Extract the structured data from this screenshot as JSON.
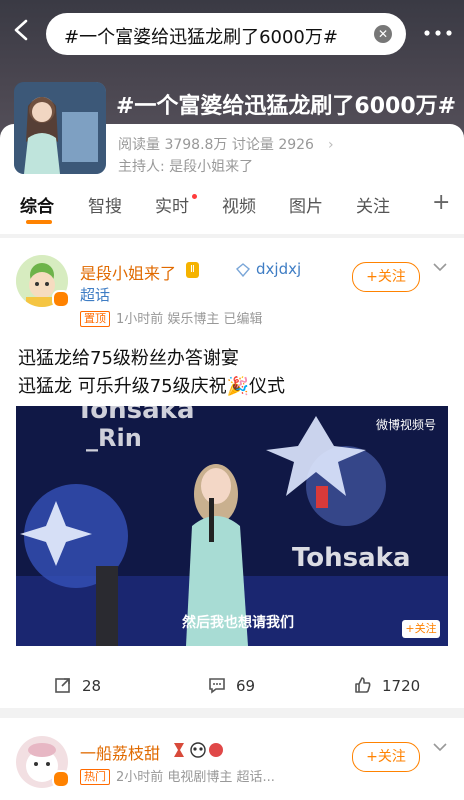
{
  "header": {
    "search_query": "#一个富婆给迅猛龙刷了6000万#"
  },
  "topic": {
    "title": "#一个富婆给迅猛龙刷了6000万#",
    "stats": "阅读量 3798.8万  讨论量 2926",
    "host": "主持人:  是段小姐来了"
  },
  "tabs": [
    {
      "label": "综合"
    },
    {
      "label": "智搜"
    },
    {
      "label": "实时"
    },
    {
      "label": "视频"
    },
    {
      "label": "图片"
    },
    {
      "label": "关注"
    }
  ],
  "post1": {
    "author": "是段小姐来了",
    "level_badge": "Ⅱ",
    "handle": "dxjdxj",
    "super_topic": "超话",
    "pinned_tag": "置顶",
    "meta": "1小时前  娱乐博主 已编辑",
    "follow_label": "+关注",
    "text_line1": "迅猛龙给75级粉丝办答谢宴",
    "text_line2": "迅猛龙 可乐升级75级庆祝🎉仪式",
    "video_logo": "微博视频号",
    "video_caption": "然后我也想请我们",
    "video_follow": "+关注",
    "reposts": "28",
    "comments": "69",
    "likes": "1720"
  },
  "post2": {
    "author": "一船荔枝甜",
    "hot_tag": "热门",
    "meta": "2小时前  电视剧博主 超话...",
    "follow_label": "+关注"
  },
  "colors": {
    "accent": "#ff8200",
    "link": "#3f7dc4"
  }
}
